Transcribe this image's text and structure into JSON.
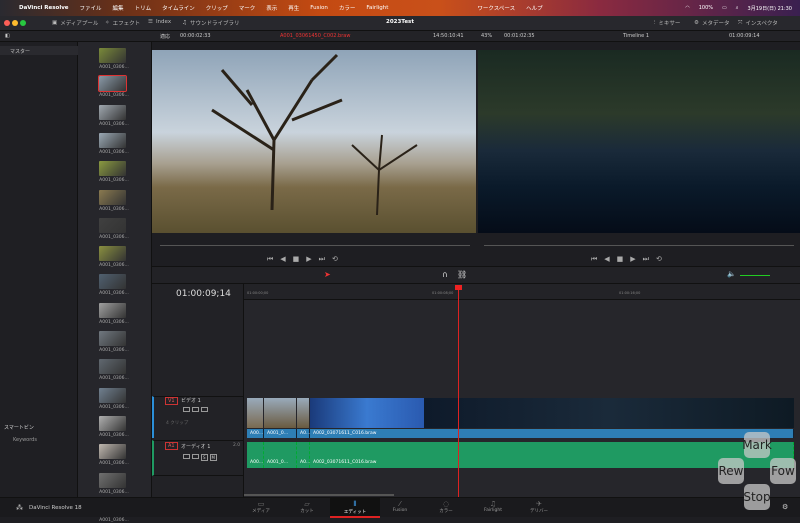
{
  "menubar": {
    "app": "DaVinci Resolve",
    "items": [
      "ファイル",
      "編集",
      "トリム",
      "タイムライン",
      "クリップ",
      "マーク",
      "表示",
      "再生",
      "Fusion",
      "カラー",
      "Fairlight",
      "ワークスペース",
      "ヘルプ"
    ],
    "battery": "100%",
    "datetime": "3月19日(日) 21:30"
  },
  "titlebar": {
    "title": "2023Test",
    "media_pool": "メディアプール",
    "effects": "エフェクト",
    "index": "Index",
    "sound_library": "サウンドライブラリ",
    "mixer": "ミキサー",
    "metadata": "メタデータ",
    "inspector": "インスペクタ"
  },
  "toolrow": {
    "fit": "適応",
    "src_duration": "00:00:02:33",
    "clip_name": "A001_03061450_C002.braw",
    "src_tc": "14:50:10:41",
    "zoom": "43%",
    "prg_duration": "00:01:02:35",
    "timeline": "Timeline 1",
    "prg_tc": "01:00:09:14"
  },
  "bins": {
    "master": "マスター",
    "smart_bins": "スマートビン",
    "keywords": "Keywords"
  },
  "pool": {
    "clip_label": "A001_0306..."
  },
  "timeline": {
    "timecode": "01:00:09;14",
    "ruler": [
      "01:00:00;00",
      "01:00:08;00",
      "01:00:16;00"
    ],
    "v1": {
      "id": "V1",
      "name": "ビデオ 1",
      "clips_count": "4 クリップ"
    },
    "a1": {
      "id": "A1",
      "name": "オーディオ 1",
      "level": "2.0",
      "solo": "S",
      "mute": "M"
    },
    "clips": [
      "A00...",
      "A001_0...",
      "A0...",
      "A002_03071611_C016.braw"
    ]
  },
  "pages": {
    "brand": "DaVinci Resolve 18",
    "items": [
      "メディア",
      "カット",
      "エディット",
      "Fusion",
      "カラー",
      "Fairlight",
      "デリバー"
    ]
  },
  "overlay": {
    "up": "Mark",
    "left": "Rew",
    "right": "Fow",
    "down": "Stop"
  }
}
